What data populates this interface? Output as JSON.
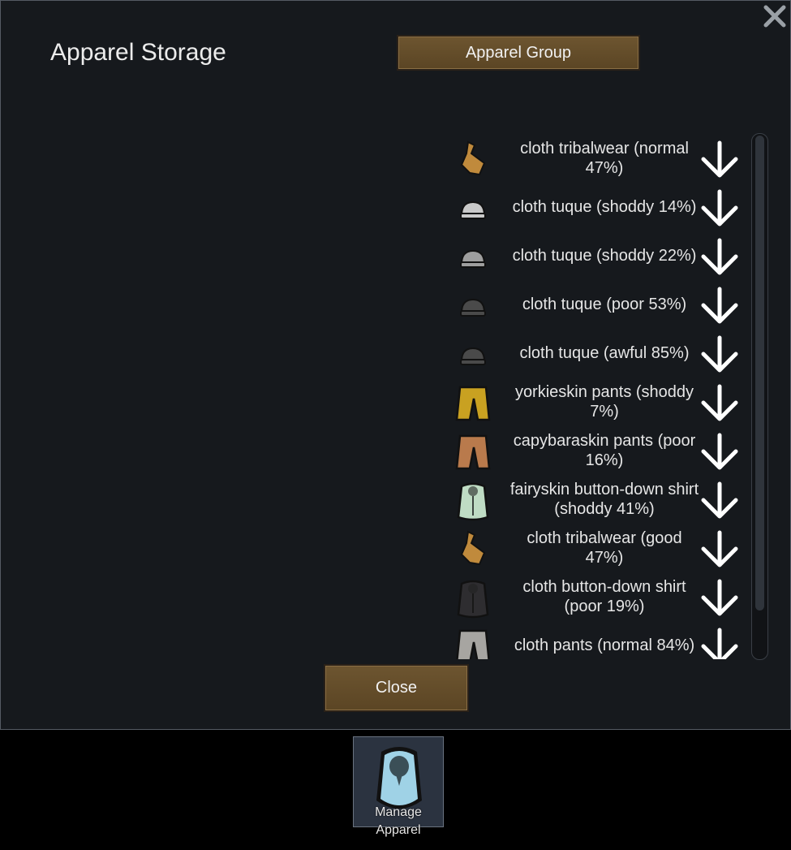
{
  "dialog": {
    "title": "Apparel Storage",
    "group_button": "Apparel Group",
    "close_button": "Close",
    "close_icon": "close-x-icon"
  },
  "items": [
    {
      "label": "cloth tribalwear (normal 47%)",
      "icon": "tribalwear-icon",
      "color": "#c08a3c"
    },
    {
      "label": "cloth tuque (shoddy 14%)",
      "icon": "tuque-icon",
      "color": "#c9c9c9"
    },
    {
      "label": "cloth tuque (shoddy 22%)",
      "icon": "tuque-icon",
      "color": "#9e9e9e"
    },
    {
      "label": "cloth tuque (poor 53%)",
      "icon": "tuque-icon",
      "color": "#4a4a4a"
    },
    {
      "label": "cloth tuque (awful 85%)",
      "icon": "tuque-icon",
      "color": "#4a4a4a"
    },
    {
      "label": "yorkieskin pants (shoddy 7%)",
      "icon": "pants-icon",
      "color": "#c9a121"
    },
    {
      "label": "capybaraskin pants (poor 16%)",
      "icon": "pants-icon",
      "color": "#b97a4c"
    },
    {
      "label": "fairyskin button-down shirt (shoddy 41%)",
      "icon": "shirt-icon",
      "color": "#bfdcc4"
    },
    {
      "label": "cloth tribalwear (good 47%)",
      "icon": "tribalwear-icon",
      "color": "#c08a3c"
    },
    {
      "label": "cloth button-down shirt (poor 19%)",
      "icon": "shirt-icon",
      "color": "#2e2d30"
    },
    {
      "label": "cloth pants (normal 84%)",
      "icon": "pants-icon",
      "color": "#a7a5a1"
    }
  ],
  "list": {
    "drop_icon": "drop-arrow-icon"
  },
  "bottom_bar": {
    "manage_apparel_label": "Manage Apparel",
    "icon": "apparel-shirt-icon"
  }
}
